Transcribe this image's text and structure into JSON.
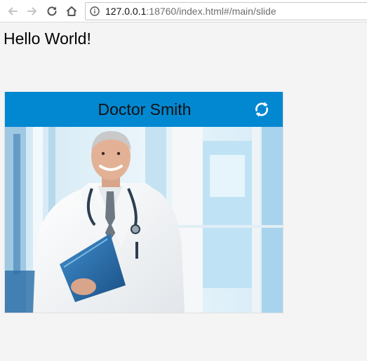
{
  "browser": {
    "url_host": "127.0.0.1",
    "url_rest": ":18760/index.html#/main/slide",
    "icons": {
      "back": "arrow-left-icon",
      "forward": "arrow-right-icon",
      "reload": "reload-icon",
      "home": "home-icon",
      "info": "info-icon"
    }
  },
  "page": {
    "heading": "Hello World!"
  },
  "card": {
    "title": "Doctor Smith",
    "header_color": "#0288d1",
    "refresh_icon": "refresh-icon",
    "photo_subject": "doctor-photo"
  }
}
